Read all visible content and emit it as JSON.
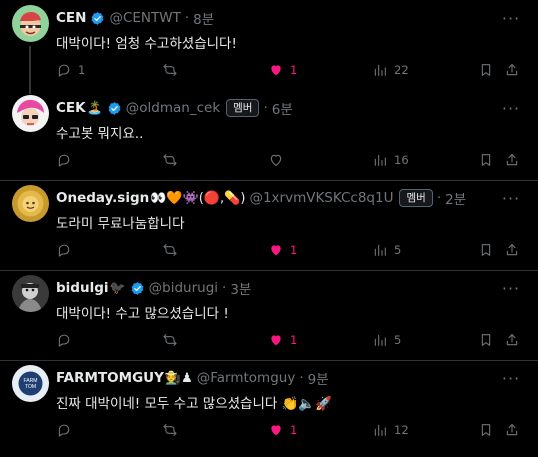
{
  "tweets": [
    {
      "name": "CEN",
      "name_emoji": "",
      "verified": true,
      "handle": "@CENTWT",
      "time": "8분",
      "badge": "",
      "text": "대박이다! 엄청 수고하셨습니다!",
      "reply_count": "1",
      "retweet_count": "",
      "like_count": "1",
      "liked": true,
      "view_count": "22"
    },
    {
      "name": "CEK",
      "name_emoji": "🏝️",
      "verified": true,
      "handle": "@oldman_cek",
      "time": "6분",
      "badge": "멤버",
      "text": "수고봇 뭐지요..",
      "reply_count": "",
      "retweet_count": "",
      "like_count": "",
      "liked": false,
      "view_count": "16"
    },
    {
      "name": "Oneday.sign",
      "name_emoji": "👀🧡👾(🔴,💊)",
      "verified": false,
      "handle": "@1xrvmVKSKCc8q1U",
      "time": "2분",
      "badge": "멤버",
      "text": "도라미 무료나눔합니다",
      "reply_count": "",
      "retweet_count": "",
      "like_count": "1",
      "liked": true,
      "view_count": "5"
    },
    {
      "name": "bidulgi",
      "name_emoji": "🐦‍⬛",
      "verified": true,
      "handle": "@bidurugi",
      "time": "3분",
      "badge": "",
      "text": "대박이다! 수고 많으셨습니다 !",
      "reply_count": "",
      "retweet_count": "",
      "like_count": "1",
      "liked": true,
      "view_count": "5"
    },
    {
      "name": "FARMTOMGUY",
      "name_emoji": "🧑‍🌾♟",
      "verified": false,
      "handle": "@Farmtomguy",
      "time": "9분",
      "badge": "",
      "text": "진짜 대박이네! 모두 수고 많으셨습니다 👏🔈🚀",
      "reply_count": "",
      "retweet_count": "",
      "like_count": "1",
      "liked": true,
      "view_count": "12"
    }
  ],
  "icons": {
    "reply": "reply-icon",
    "retweet": "retweet-icon",
    "like": "heart-icon",
    "views": "views-icon",
    "bookmark": "bookmark-icon",
    "share": "share-icon",
    "more": "more-icon"
  },
  "colors": {
    "background": "#000000",
    "muted": "#71767b",
    "like_active": "#f91880",
    "verified": "#1d9bf0"
  }
}
